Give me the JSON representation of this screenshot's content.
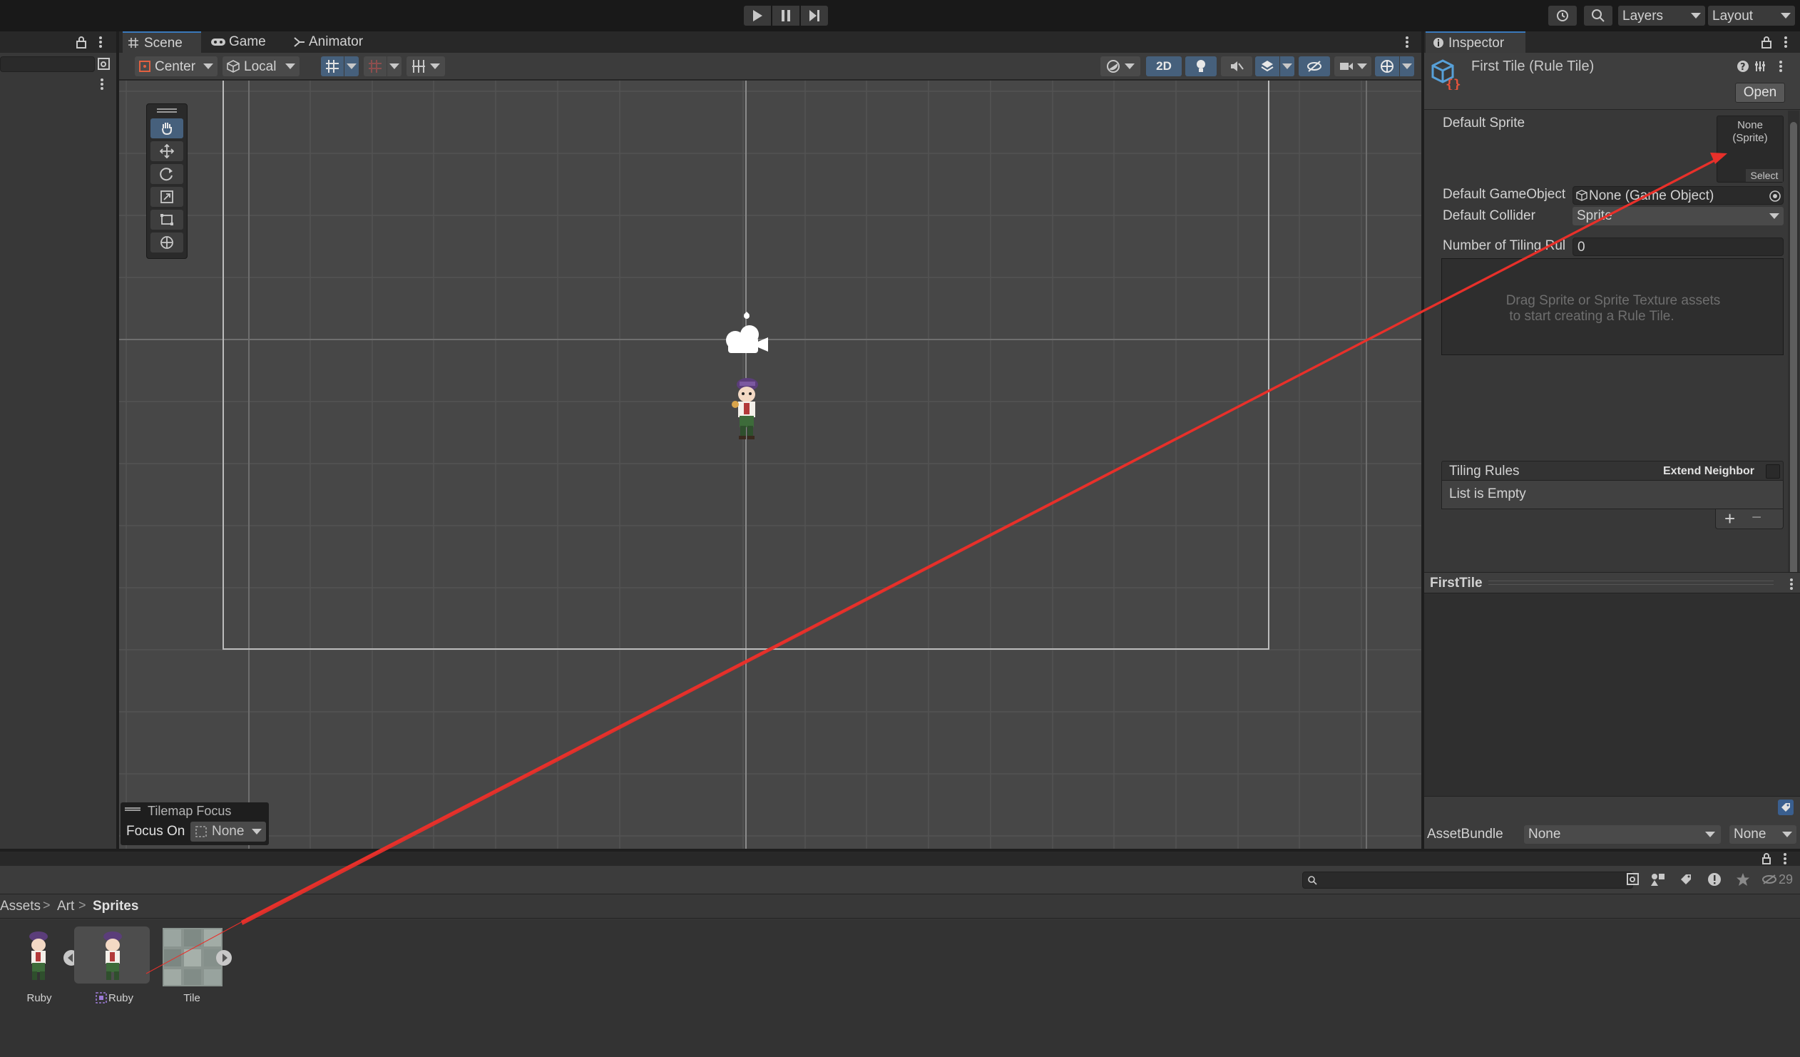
{
  "toolbar": {
    "layers_label": "Layers",
    "layout_label": "Layout"
  },
  "tabs": {
    "scene": "Scene",
    "game": "Game",
    "animator": "Animator"
  },
  "scene_toolbar": {
    "pivot_mode": "Center",
    "pivot_rotation": "Local",
    "mode_2d": "2D"
  },
  "tilemap_focus": {
    "title": "Tilemap Focus",
    "focus_on_label": "Focus On",
    "focus_value": "None"
  },
  "inspector": {
    "tab_label": "Inspector",
    "asset_title": "First Tile (Rule Tile)",
    "open_button": "Open",
    "default_sprite_label": "Default Sprite",
    "sprite_none_line1": "None",
    "sprite_none_line2": "(Sprite)",
    "sprite_select": "Select",
    "default_gameobject_label": "Default GameObject",
    "default_gameobject_value": "None (Game Object)",
    "default_collider_label": "Default Collider",
    "default_collider_value": "Sprite",
    "number_of_tiling_rules_label": "Number of Tiling Rul",
    "number_of_tiling_rules_value": "0",
    "drag_hint_line1": "Drag Sprite or Sprite Texture assets",
    "drag_hint_line2": "to start creating a Rule Tile.",
    "tiling_rules_label": "Tiling Rules",
    "extend_neighbor_label": "Extend Neighbor",
    "list_empty": "List is Empty",
    "preview_title": "FirstTile",
    "assetbundle_label": "AssetBundle",
    "assetbundle_value": "None",
    "assetbundle_variant": "None"
  },
  "project": {
    "breadcrumb": [
      "Assets",
      "Art",
      "Sprites"
    ],
    "hidden_count": "29",
    "assets": [
      {
        "name": "Ruby"
      },
      {
        "name": "Ruby"
      },
      {
        "name": "Tile"
      }
    ]
  },
  "colors": {
    "accent_blue": "#46607c",
    "annotation_red": "#e8302a"
  }
}
